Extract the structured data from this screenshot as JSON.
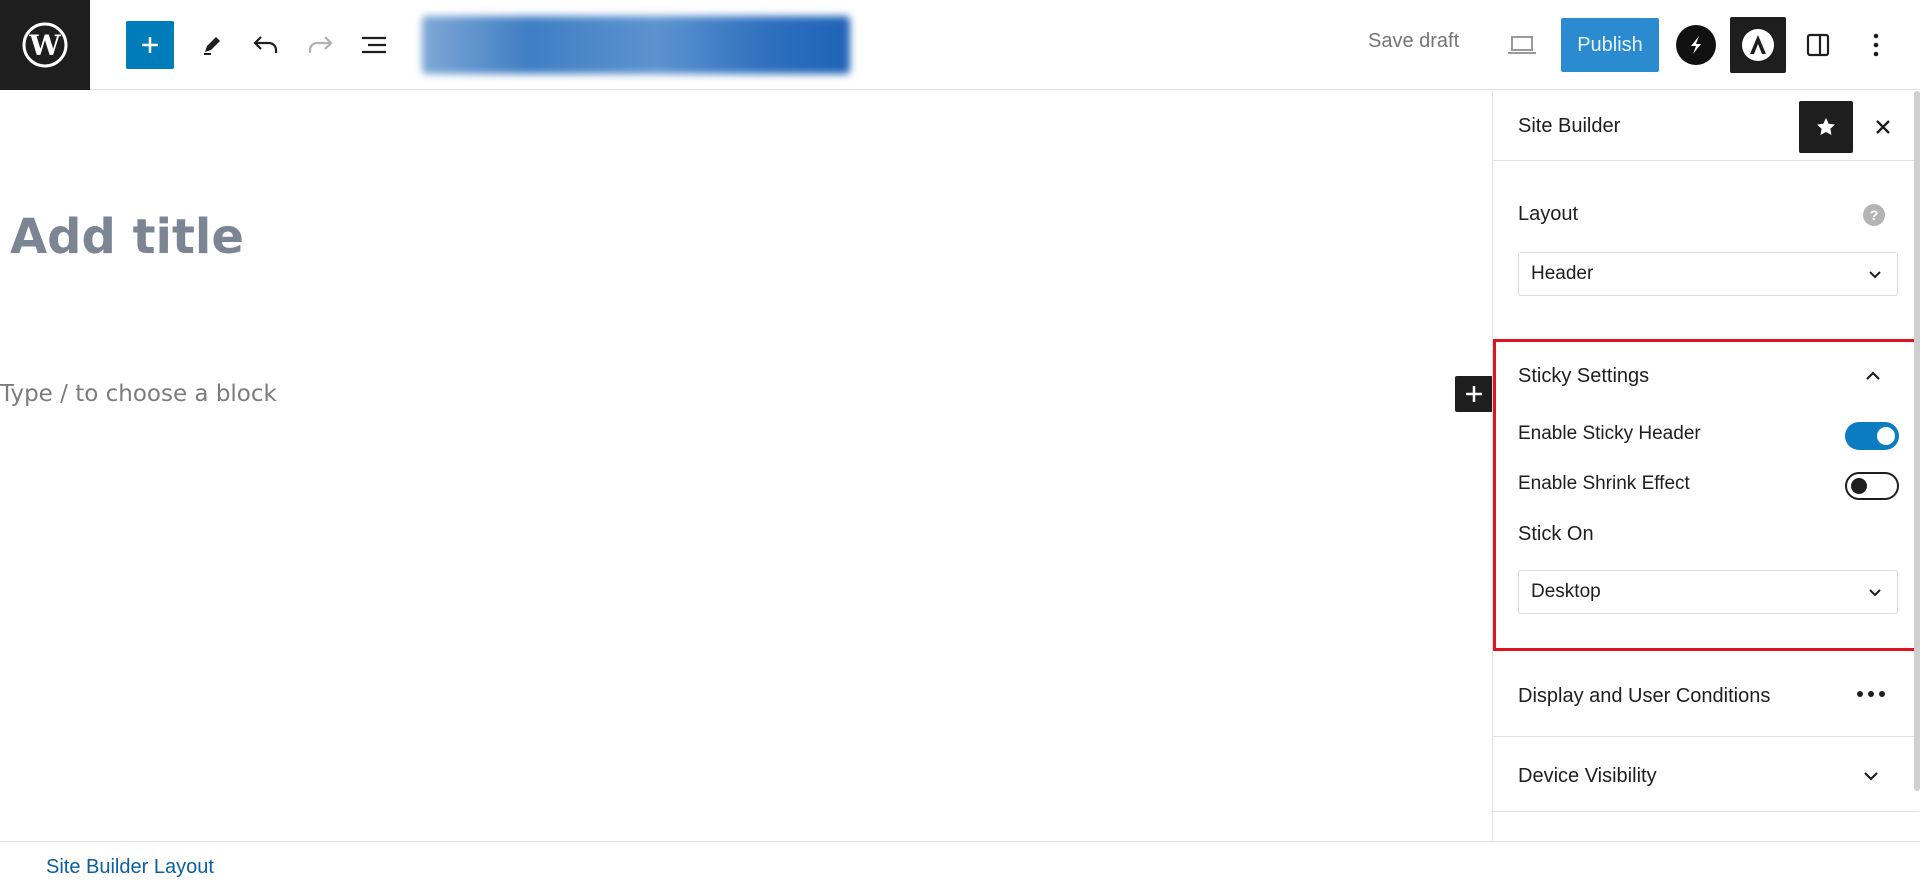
{
  "toolbar": {
    "wp_logo_icon": "wordpress-logo",
    "add_block_icon": "plus-icon",
    "tools_icon": "pencil-icon",
    "undo_icon": "undo-icon",
    "redo_icon": "redo-icon",
    "list_view_icon": "list-view-icon",
    "save_draft_label": "Save draft",
    "preview_icon": "laptop-icon",
    "publish_label": "Publish",
    "spectra_icon": "spectra-icon",
    "astra_icon": "astra-icon",
    "settings_icon": "sidebar-toggle-icon",
    "options_icon": "vertical-ellipsis-icon"
  },
  "editor": {
    "title_placeholder": "Add title",
    "block_placeholder": "Type / to choose a block"
  },
  "sidebar": {
    "title": "Site Builder",
    "layout": {
      "label": "Layout",
      "help_symbol": "?",
      "selected": "Header"
    },
    "sticky_settings": {
      "title": "Sticky Settings",
      "enable_sticky_header_label": "Enable Sticky Header",
      "enable_sticky_header": true,
      "enable_shrink_effect_label": "Enable Shrink Effect",
      "enable_shrink_effect": false,
      "stick_on_label": "Stick On",
      "stick_on_selected": "Desktop"
    },
    "display_conditions_title": "Display and User Conditions",
    "device_visibility_title": "Device Visibility"
  },
  "footer": {
    "breadcrumb": "Site Builder Layout"
  },
  "colors": {
    "accent": "#007cba",
    "publish": "#2a8bd1",
    "highlight": "#e0141e"
  }
}
